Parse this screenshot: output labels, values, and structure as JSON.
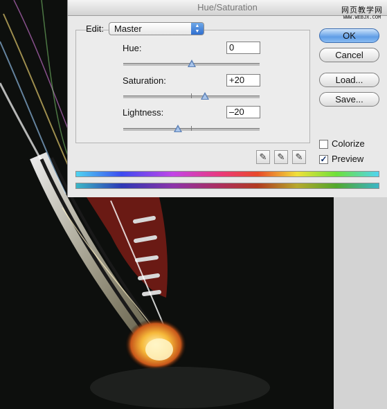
{
  "window": {
    "title": "Hue/Saturation"
  },
  "watermark": {
    "line1": "网页教学网",
    "line2": "WWW.WEBJX.COM"
  },
  "edit": {
    "label": "Edit:",
    "selected": "Master"
  },
  "sliders": [
    {
      "label": "Hue:",
      "value": "0",
      "level": 0.5
    },
    {
      "label": "Saturation:",
      "value": "+20",
      "level": 0.6
    },
    {
      "label": "Lightness:",
      "value": "–20",
      "level": 0.4
    }
  ],
  "buttons": {
    "ok": "OK",
    "cancel": "Cancel",
    "load": "Load...",
    "save": "Save..."
  },
  "options": {
    "colorize": {
      "label": "Colorize",
      "checked": false
    },
    "preview": {
      "label": "Preview",
      "checked": true
    }
  },
  "icons": {
    "eyedroppers": [
      "eyedropper-icon",
      "eyedropper-plus-icon",
      "eyedropper-minus-icon"
    ]
  },
  "colors": {
    "accent": "#5f9de6",
    "thumb": "#5a7fb5"
  }
}
